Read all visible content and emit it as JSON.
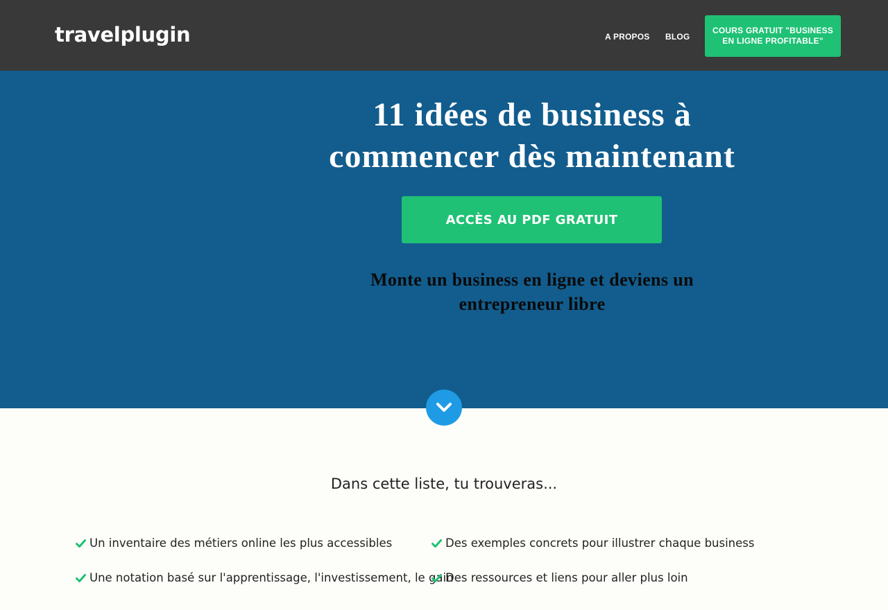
{
  "header": {
    "logo_text": "travelplugin",
    "nav": {
      "about_label": "A PROPOS",
      "blog_label": "BLOG"
    },
    "cta_label": "COURS GRATUIT \"BUSINESS EN LIGNE PROFITABLE\"",
    "background_color": "#393939",
    "cta_color": "#1fc174"
  },
  "hero": {
    "title": "11 idées de business à commencer dès maintenant",
    "cta_label": "ACCÈS AU PDF GRATUIT",
    "subtitle": "Monte un business en ligne et deviens un entrepreneur libre",
    "background_color": "#125d8e",
    "scroll_icon": "chevron-down-icon"
  },
  "list_section": {
    "heading": "Dans cette liste, tu trouveras...",
    "check_icon": "check-icon",
    "check_color": "#1fc174",
    "items": [
      "Un inventaire des métiers online les plus accessibles",
      "Des exemples concrets pour illustrer chaque business",
      "Une notation basé sur l'apprentissage, l'investissement, le gain",
      "Des ressources et liens pour aller plus loin"
    ]
  }
}
